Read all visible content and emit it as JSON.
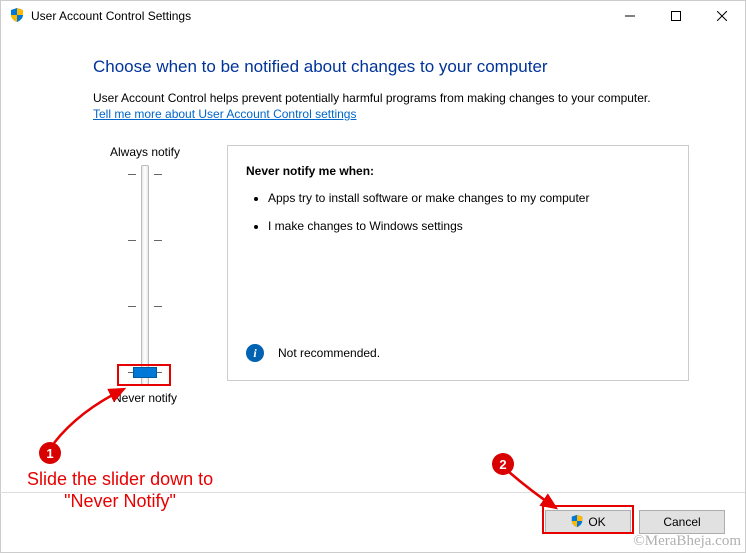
{
  "window": {
    "title": "User Account Control Settings"
  },
  "content": {
    "heading": "Choose when to be notified about changes to your computer",
    "description": "User Account Control helps prevent potentially harmful programs from making changes to your computer.",
    "link": "Tell me more about User Account Control settings"
  },
  "slider": {
    "top_label": "Always notify",
    "bottom_label": "Never notify"
  },
  "panel": {
    "title": "Never notify me when:",
    "items": [
      "Apps try to install software or make changes to my computer",
      "I make changes to Windows settings"
    ],
    "recommend": "Not recommended."
  },
  "buttons": {
    "ok": "OK",
    "cancel": "Cancel"
  },
  "annotations": {
    "step1_num": "1",
    "step2_num": "2",
    "step1_text_l1": "Slide the slider down to",
    "step1_text_l2": "\"Never Notify\""
  },
  "watermark": "©MeraBheja.com"
}
